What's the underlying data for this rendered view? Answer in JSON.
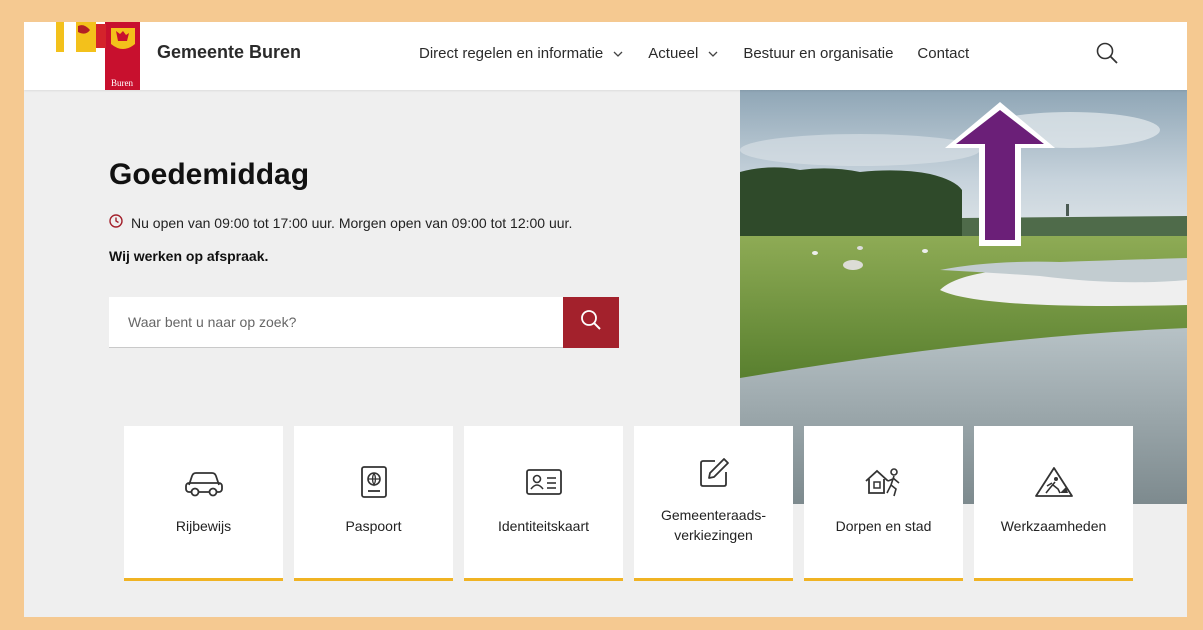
{
  "header": {
    "logo_text": "Buren",
    "site_name": "Gemeente Buren",
    "nav": [
      {
        "label": "Direct regelen en informatie",
        "icon": "chevron-down-icon"
      },
      {
        "label": "Actueel",
        "icon": "chevron-down-icon"
      },
      {
        "label": "Bestuur en organisatie"
      },
      {
        "label": "Contact"
      }
    ],
    "search_icon": "search-icon"
  },
  "hero": {
    "greeting": "Goedemiddag",
    "hours": "Nu open van 09:00 tot 17:00 uur. Morgen open van 09:00 tot 12:00 uur.",
    "hours_icon": "clock-icon",
    "appointment": "Wij werken op afspraak.",
    "search": {
      "placeholder": "Waar bent u naar op zoek?",
      "button_icon": "search-icon"
    }
  },
  "tiles": [
    {
      "label": "Rijbewijs",
      "icon": "car-icon"
    },
    {
      "label": "Paspoort",
      "icon": "passport-icon"
    },
    {
      "label": "Identiteitskaart",
      "icon": "id-card-icon"
    },
    {
      "label": "Gemeenteraads-\nverkiezingen",
      "label_line1": "Gemeenteraads-",
      "label_line2": "verkiezingen",
      "icon": "edit-icon"
    },
    {
      "label": "Dorpen en stad",
      "icon": "village-icon"
    },
    {
      "label": "Werkzaamheden",
      "icon": "roadwork-icon"
    }
  ],
  "annotation": {
    "icon": "up-arrow-icon",
    "color": "#6b1f78",
    "points_to": "Contact"
  },
  "colors": {
    "accent_red": "#a3212c",
    "tile_border": "#f0b323",
    "frame": "#f5c991",
    "background": "#efefef"
  }
}
